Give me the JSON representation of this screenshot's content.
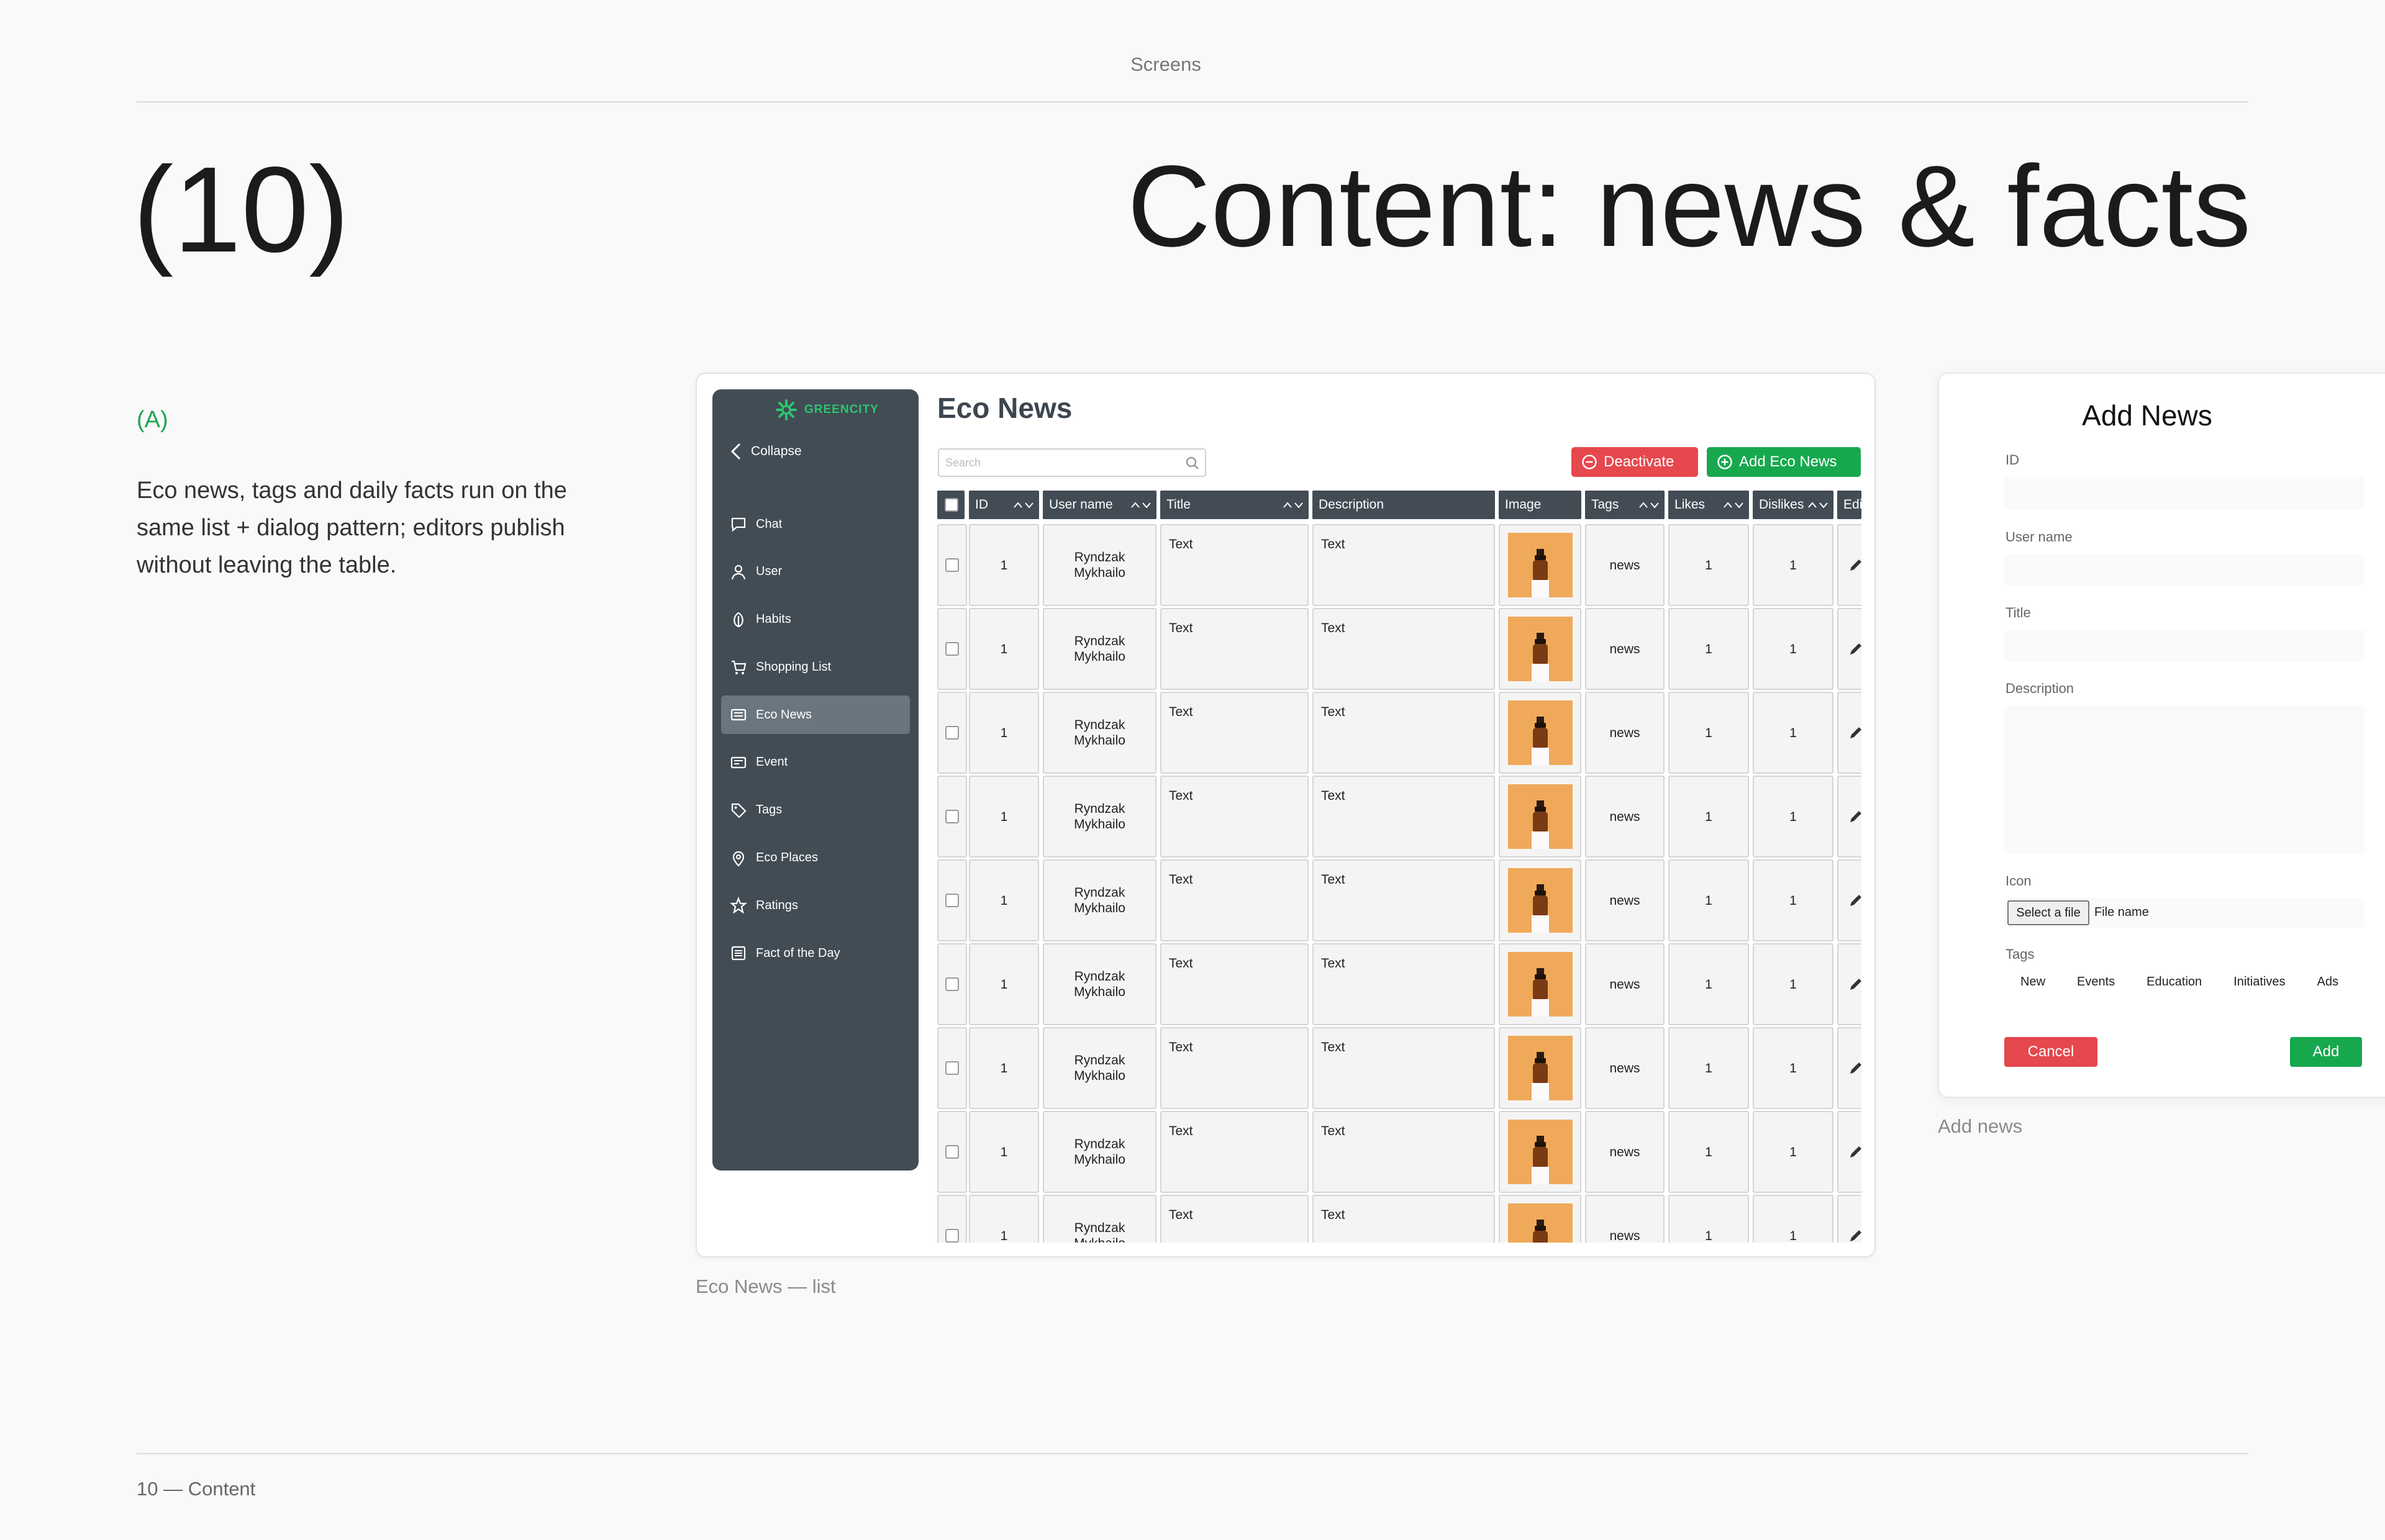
{
  "page": {
    "top_label": "Screens",
    "number": "(10)",
    "title": "Content: news & facts",
    "section_label": "(A)",
    "description": "Eco news, tags and daily facts run on the same list + dialog pattern; editors publish without leaving the table.",
    "footer": "10 — Content",
    "caption_list": "Eco News — list",
    "caption_dialog": "Add news"
  },
  "app": {
    "logo": "GREENCITY",
    "collapse": "Collapse",
    "nav": [
      {
        "label": "Chat",
        "icon": "chat-icon"
      },
      {
        "label": "User",
        "icon": "user-icon"
      },
      {
        "label": "Habits",
        "icon": "leaf-icon"
      },
      {
        "label": "Shopping List",
        "icon": "cart-icon"
      },
      {
        "label": "Eco News",
        "icon": "news-icon",
        "active": true
      },
      {
        "label": "Event",
        "icon": "event-icon"
      },
      {
        "label": "Tags",
        "icon": "tag-icon"
      },
      {
        "label": "Eco Places",
        "icon": "pin-icon"
      },
      {
        "label": "Ratings",
        "icon": "star-icon"
      },
      {
        "label": "Fact of the Day",
        "icon": "fact-icon"
      }
    ],
    "panel_title": "Eco News",
    "search_placeholder": "Search",
    "deactivate": "Deactivate",
    "add_news": "Add Eco News",
    "columns": [
      "ID",
      "User name",
      "Title",
      "Description",
      "Image",
      "Tags",
      "Likes",
      "Dislikes",
      "Edit"
    ],
    "rows": [
      {
        "id": "1",
        "user": "Ryndzak Mykhailo",
        "title": "Text",
        "description": "Text",
        "tags": "news",
        "likes": "1",
        "dislikes": "1"
      },
      {
        "id": "1",
        "user": "Ryndzak Mykhailo",
        "title": "Text",
        "description": "Text",
        "tags": "news",
        "likes": "1",
        "dislikes": "1"
      },
      {
        "id": "1",
        "user": "Ryndzak Mykhailo",
        "title": "Text",
        "description": "Text",
        "tags": "news",
        "likes": "1",
        "dislikes": "1"
      },
      {
        "id": "1",
        "user": "Ryndzak Mykhailo",
        "title": "Text",
        "description": "Text",
        "tags": "news",
        "likes": "1",
        "dislikes": "1"
      },
      {
        "id": "1",
        "user": "Ryndzak Mykhailo",
        "title": "Text",
        "description": "Text",
        "tags": "news",
        "likes": "1",
        "dislikes": "1"
      },
      {
        "id": "1",
        "user": "Ryndzak Mykhailo",
        "title": "Text",
        "description": "Text",
        "tags": "news",
        "likes": "1",
        "dislikes": "1"
      },
      {
        "id": "1",
        "user": "Ryndzak Mykhailo",
        "title": "Text",
        "description": "Text",
        "tags": "news",
        "likes": "1",
        "dislikes": "1"
      },
      {
        "id": "1",
        "user": "Ryndzak Mykhailo",
        "title": "Text",
        "description": "Text",
        "tags": "news",
        "likes": "1",
        "dislikes": "1"
      },
      {
        "id": "1",
        "user": "Ryndzak Mykhailo",
        "title": "Text",
        "description": "Text",
        "tags": "news",
        "likes": "1",
        "dislikes": "1"
      }
    ]
  },
  "dialog": {
    "title": "Add News",
    "labels": {
      "id": "ID",
      "user": "User name",
      "title": "Title",
      "description": "Description",
      "icon": "Icon",
      "tags": "Tags"
    },
    "file_button": "Select a file",
    "file_name": "File name",
    "tags": [
      "New",
      "Events",
      "Education",
      "Initiatives",
      "Ads"
    ],
    "cancel": "Cancel",
    "add": "Add"
  },
  "colors": {
    "brand": "#2cc56f",
    "sidebar": "#424c54",
    "danger": "#e5484d",
    "success": "#17a84e"
  }
}
